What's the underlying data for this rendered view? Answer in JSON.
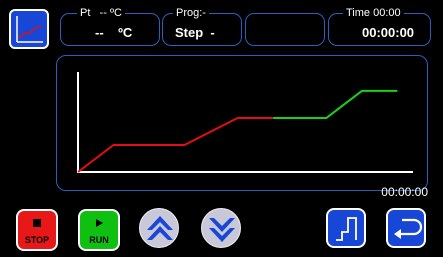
{
  "header": {
    "temp_panel": {
      "label": "Pt   -- ºC",
      "value": "--    ºC"
    },
    "prog_panel": {
      "label": "Prog:-",
      "value": "Step  -"
    },
    "empty_panel": {
      "label": "",
      "value": ""
    },
    "time_panel": {
      "label": "Time 00:00",
      "value": "00:00:00"
    }
  },
  "chart": {
    "elapsed": "00:00:00",
    "colors": {
      "done": "#e01010",
      "pending": "#18d018",
      "axis": "#ffffff",
      "frame": "#2a5fc0"
    }
  },
  "chart_data": {
    "type": "line",
    "series": [
      {
        "values_x": [
          0,
          1,
          3,
          4.5,
          5.5
        ],
        "values_y": [
          0,
          1,
          1,
          2,
          2
        ]
      },
      {
        "values_x": [
          5.5,
          7,
          8,
          9
        ],
        "values_y": [
          2,
          2,
          3,
          3
        ]
      }
    ],
    "xlim": [
      0,
      9.3
    ],
    "ylim": [
      0,
      3.7
    ]
  },
  "controls": {
    "stop": {
      "label": "STOP",
      "color": "#e81818",
      "icon": "stop-square-icon"
    },
    "run": {
      "label": "RUN",
      "color": "#10c010",
      "icon": "play-triangle-icon"
    },
    "up": {
      "icon": "double-chevron-up-icon"
    },
    "down": {
      "icon": "double-chevron-down-icon"
    },
    "program": {
      "icon": "program-steps-icon"
    },
    "back": {
      "icon": "return-arrow-icon"
    }
  }
}
